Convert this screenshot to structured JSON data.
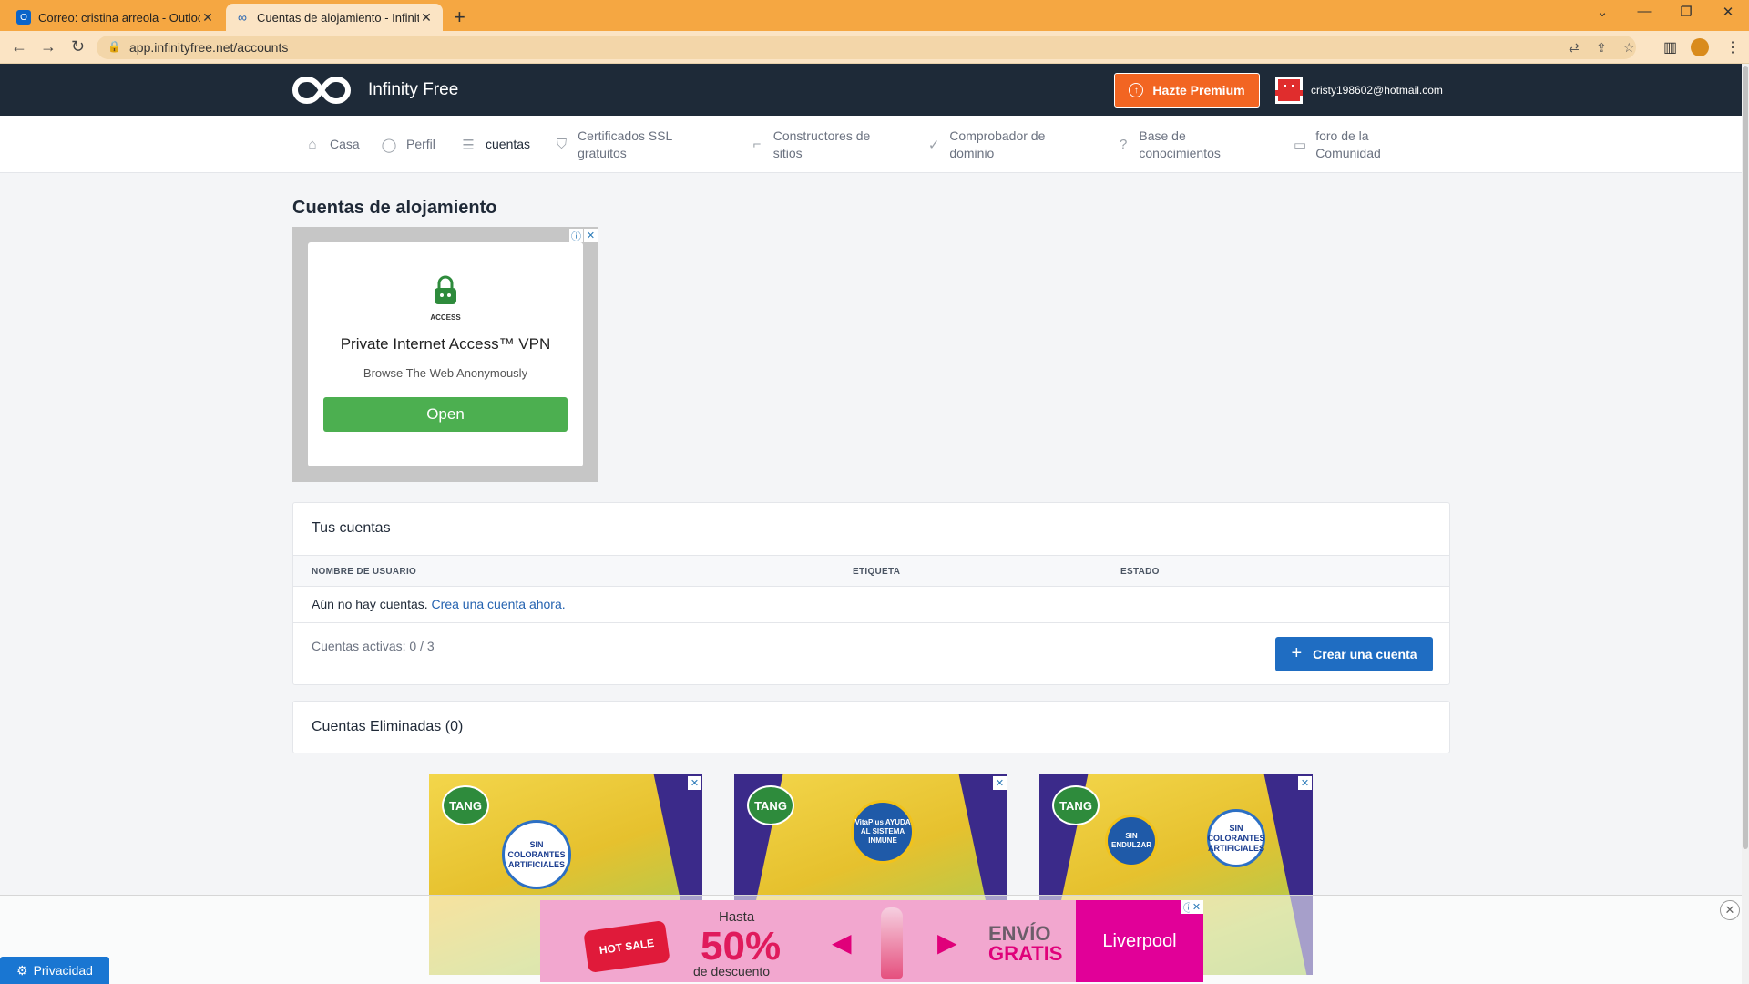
{
  "browser": {
    "tabs": [
      {
        "title": "Correo: cristina arreola - Outlook",
        "active": false
      },
      {
        "title": "Cuentas de alojamiento - Infinity",
        "active": true
      }
    ],
    "url": "app.infinityfree.net/accounts",
    "accent_color": "#f5a742"
  },
  "site": {
    "brand": "Infinity Free",
    "premium_label": "Hazte Premium",
    "user_email": "cristy198602@hotmail.com",
    "nav": [
      {
        "label": "Casa",
        "icon": "home-icon"
      },
      {
        "label": "Perfil",
        "icon": "user-icon"
      },
      {
        "label": "cuentas",
        "icon": "server-icon",
        "active": true
      },
      {
        "label": "Certificados SSL gratuitos",
        "icon": "shield-icon"
      },
      {
        "label": "Constructores de sitios",
        "icon": "paint-roller-icon"
      },
      {
        "label": "Comprobador de dominio",
        "icon": "check-circle-icon"
      },
      {
        "label": "Base de conocimientos",
        "icon": "help-circle-icon"
      },
      {
        "label": "foro de la Comunidad",
        "icon": "chat-icon"
      }
    ]
  },
  "main": {
    "title": "Cuentas de alojamiento",
    "ad": {
      "brand_small": "ACCESS",
      "headline": "Private Internet Access™ VPN",
      "subline": "Browse The Web Anonymously",
      "cta": "Open"
    },
    "accounts_panel": {
      "title": "Tus cuentas",
      "columns": [
        "NOMBRE DE USUARIO",
        "ETIQUETA",
        "ESTADO"
      ],
      "empty_text": "Aún no hay cuentas.",
      "empty_link": "Crea una cuenta ahora.",
      "active_count": "Cuentas activas: 0 / 3",
      "create_button": "Crear una cuenta"
    },
    "deleted_panel": {
      "title": "Cuentas Eliminadas (0)"
    },
    "tang_ads": [
      {
        "badge": "TANG",
        "seal": "SIN COLORANTES ARTIFICIALES"
      },
      {
        "badge": "TANG",
        "seal": "VitaPlus AYUDA AL SISTEMA INMUNE"
      },
      {
        "badge": "TANG",
        "seal": "SIN ENDULZAR",
        "seal2": "SIN COLORANTES ARTIFICIALES"
      }
    ]
  },
  "bottom_ad": {
    "hot_sale": "HOT SALE",
    "hasta": "Hasta",
    "percent": "50%",
    "descuento": "de descuento",
    "envio": "ENVÍO",
    "gratis": "GRATIS",
    "store": "Liverpool"
  },
  "privacy_label": "Privacidad"
}
